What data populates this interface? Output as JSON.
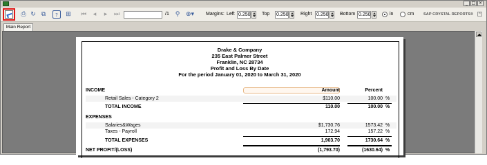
{
  "toolbar": {
    "page_total": "/1",
    "margins_label": "Margins:",
    "left_label": "Left",
    "left_value": "0.250",
    "top_label": "Top",
    "top_value": "0.250",
    "right_label": "Right",
    "right_value": "0.250",
    "bottom_label": "Bottom",
    "bottom_value": "0.250",
    "unit_in": "in",
    "unit_cm": "cm",
    "brand": "SAP CRYSTAL REPORTS®"
  },
  "tabs": [
    "Main Report"
  ],
  "report": {
    "company": "Drake & Company",
    "address1": "235 East Palmer Street",
    "address2": "Franklin, NC 28734",
    "title": "Profit and Loss By Date",
    "period": "For the period January 01, 2020 to March 31, 2020",
    "col_amount": "Amount",
    "col_percent": "Percent",
    "income": {
      "heading": "INCOME",
      "rows": [
        {
          "label": "Retail Sales - Category 2",
          "amount": "$110.00",
          "percent": "100.00",
          "pct": "%"
        }
      ],
      "total_label": "TOTAL INCOME",
      "total_amount": "110.00",
      "total_percent": "100.00",
      "total_pct": "%"
    },
    "expenses": {
      "heading": "EXPENSES",
      "rows": [
        {
          "label": "Salaries&Wages",
          "amount": "$1,730.76",
          "percent": "1573.42",
          "pct": "%"
        },
        {
          "label": "Taxes - Payroll",
          "amount": "172.94",
          "percent": "157.22",
          "pct": "%"
        }
      ],
      "total_label": "TOTAL EXPENSES",
      "total_amount": "1,903.70",
      "total_percent": "1730.64",
      "total_pct": "%"
    },
    "net": {
      "label": "NET PROFIT/(LOSS)",
      "amount": "(1,793.70)",
      "percent": "(1630.64)",
      "pct": "%"
    }
  },
  "colors": {
    "highlight": "#e01818",
    "chrome": "#d4d0c8",
    "canvas": "#7b7b7b"
  },
  "icons": [
    "export-icon",
    "print-icon",
    "refresh-icon",
    "copy-icon",
    "toggle-tree-icon",
    "group-tree-icon",
    "first-page-icon",
    "prev-page-icon",
    "next-page-icon",
    "last-page-icon",
    "find-icon",
    "zoom-icon"
  ]
}
